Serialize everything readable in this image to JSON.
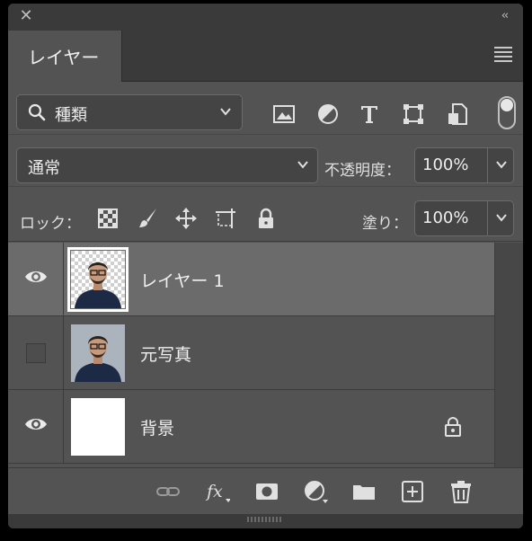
{
  "header": {
    "close_glyph": "✕",
    "collapse_glyph": "‹‹"
  },
  "tab": {
    "label": "レイヤー"
  },
  "filter": {
    "kind_label": "種類",
    "icons": [
      "image-filter-icon",
      "adjustment-filter-icon",
      "type-filter-icon",
      "shape-filter-icon",
      "smart-object-filter-icon"
    ]
  },
  "blend": {
    "mode": "通常",
    "opacity_label": "不透明度：",
    "opacity_value": "100%"
  },
  "lock": {
    "label": "ロック：",
    "icons": [
      "lock-transparent-pixels-icon",
      "lock-image-pixels-icon",
      "lock-position-icon",
      "lock-artboard-icon",
      "lock-all-icon"
    ],
    "fill_label": "塗り：",
    "fill_value": "100%"
  },
  "layers": [
    {
      "name": "レイヤー 1",
      "visible": true,
      "selected": true,
      "locked": false
    },
    {
      "name": "元写真",
      "visible": false,
      "selected": false,
      "locked": false
    },
    {
      "name": "背景",
      "visible": true,
      "selected": false,
      "locked": true
    }
  ],
  "footer": {
    "icons": [
      "link-layers-icon",
      "fx-icon",
      "layer-mask-icon",
      "adjustment-layer-icon",
      "group-folder-icon",
      "new-layer-icon",
      "trash-icon"
    ],
    "fx_text": "fx"
  },
  "colors": {
    "panel": "#535353",
    "selected_row": "#6b6b6b",
    "chrome": "#3a3a3a"
  }
}
